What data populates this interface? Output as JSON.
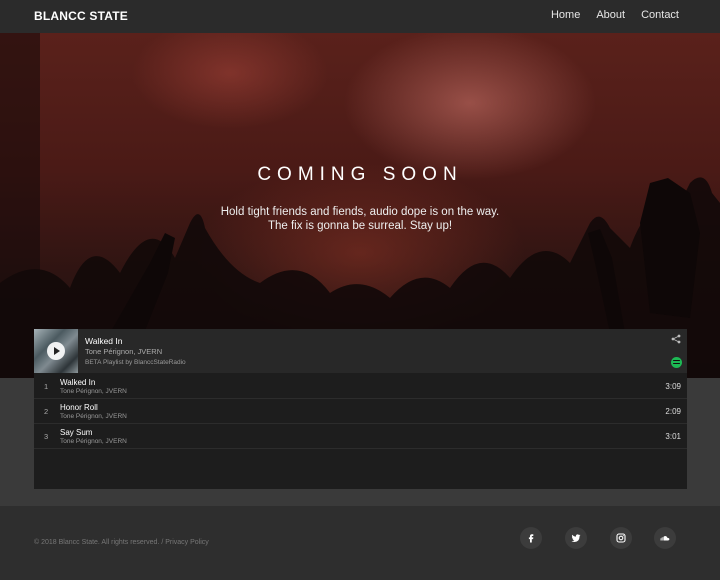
{
  "header": {
    "logo": "BLANCC STATE",
    "nav": [
      "Home",
      "About",
      "Contact"
    ]
  },
  "hero": {
    "title": "COMING SOON",
    "line1": "Hold tight friends and fiends, audio dope is on the way.",
    "line2": "The fix is gonna be surreal. Stay up!"
  },
  "player": {
    "now_title": "Walked In",
    "now_artist": "Tone Pérignon, JVERN",
    "playlist": "BETA Playlist by BlanccStateRadio",
    "tracks": [
      {
        "num": "1",
        "title": "Walked In",
        "artist": "Tone Pérignon, JVERN",
        "duration": "3:09"
      },
      {
        "num": "2",
        "title": "Honor Roll",
        "artist": "Tone Pérignon, JVERN",
        "duration": "2:09"
      },
      {
        "num": "3",
        "title": "Say Sum",
        "artist": "Tone Pérignon, JVERN",
        "duration": "3:01"
      }
    ]
  },
  "footer": {
    "copyright": "© 2018 Blancc State. All rights reserved. / Privacy Policy"
  },
  "social": [
    "facebook-icon",
    "twitter-icon",
    "instagram-icon",
    "soundcloud-icon"
  ],
  "colors": {
    "spotify": "#1db954",
    "header": "#2b2b2b",
    "player": "#1d1d1d"
  }
}
